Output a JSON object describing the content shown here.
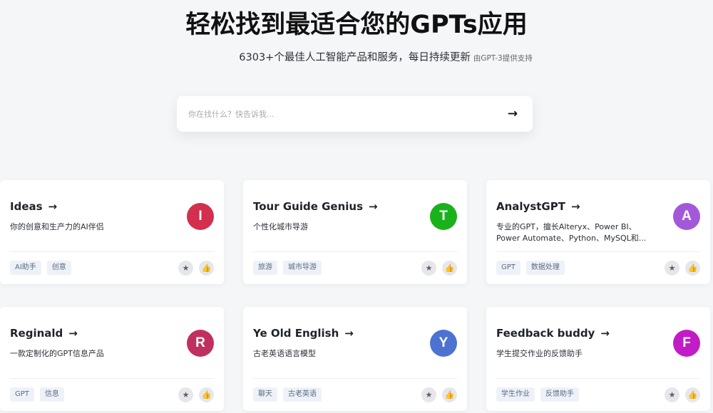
{
  "header": {
    "title": "轻松找到最适合您的GPTs应用",
    "subtitle": "6303+个最佳人工智能产品和服务，每日持续更新",
    "subtitle_small": "由GPT-3提供支持"
  },
  "search": {
    "placeholder": "你在找什么？快告诉我...",
    "arrow": "→",
    "arrow_icon": "arrow-right-icon"
  },
  "actions": {
    "star_icon": "★",
    "like_icon": "👍"
  },
  "cards": [
    {
      "name": "Ideas",
      "arrow": "→",
      "desc": "你的创意和生产力的AI伴侣",
      "avatar": "I",
      "color": "#d32f4f",
      "tags": [
        "AI助手",
        "创意"
      ]
    },
    {
      "name": "Tour Guide Genius",
      "arrow": "→",
      "desc": "个性化城市导游",
      "avatar": "T",
      "color": "#1ab21a",
      "tags": [
        "旅游",
        "城市导游"
      ]
    },
    {
      "name": "AnalystGPT",
      "arrow": "→",
      "desc": "专业的GPT，擅长Alteryx、Power BI、Power Automate、Python、MySQL和...",
      "avatar": "A",
      "color": "#a259d9",
      "tags": [
        "GPT",
        "数据处理"
      ]
    },
    {
      "name": "Reginald",
      "arrow": "→",
      "desc": "一款定制化的GPT信息产品",
      "avatar": "R",
      "color": "#c0305e",
      "tags": [
        "GPT",
        "信息"
      ]
    },
    {
      "name": "Ye Old English",
      "arrow": "→",
      "desc": "古老英语语言模型",
      "avatar": "Y",
      "color": "#4d73d1",
      "tags": [
        "聊天",
        "古老英语"
      ]
    },
    {
      "name": "Feedback buddy",
      "arrow": "→",
      "desc": "学生提交作业的反馈助手",
      "avatar": "F",
      "color": "#c21cc6",
      "tags": [
        "学生作业",
        "反馈助手"
      ]
    }
  ]
}
